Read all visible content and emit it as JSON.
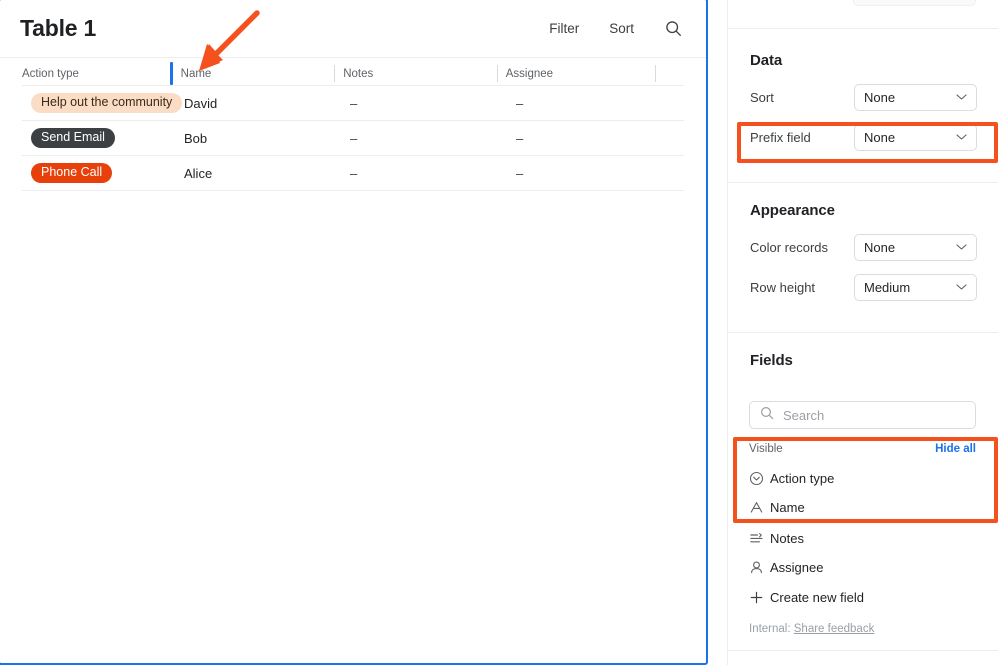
{
  "table_view": {
    "title": "Table 1",
    "toolbar": {
      "filter_label": "Filter",
      "sort_label": "Sort",
      "search_icon": "search-icon"
    },
    "columns": [
      {
        "label": "Action type"
      },
      {
        "label": "Name"
      },
      {
        "label": "Notes"
      },
      {
        "label": "Assignee"
      }
    ],
    "drag_indicator_color": "#1a73e8",
    "rows": [
      {
        "action_type": "Help out the community",
        "tag_bg": "#fbdcc5",
        "tag_fg": "#3c2a1a",
        "name": "David",
        "notes": "–",
        "assignee": "–"
      },
      {
        "action_type": "Send Email",
        "tag_bg": "#3c4043",
        "tag_fg": "#ffffff",
        "name": "Bob",
        "notes": "–",
        "assignee": "–"
      },
      {
        "action_type": "Phone Call",
        "tag_bg": "#e8400a",
        "tag_fg": "#ffffff",
        "name": "Alice",
        "notes": "–",
        "assignee": "–"
      }
    ]
  },
  "sidebar": {
    "data_section": {
      "title": "Data",
      "settings": [
        {
          "label": "Sort",
          "value": "None",
          "icon": "chevron-down-icon"
        },
        {
          "label": "Prefix field",
          "value": "None",
          "icon": "chevron-down-icon"
        }
      ]
    },
    "appearance_section": {
      "title": "Appearance",
      "settings": [
        {
          "label": "Color records",
          "value": "None",
          "icon": "chevron-down-icon"
        },
        {
          "label": "Row height",
          "value": "Medium",
          "icon": "chevron-down-icon"
        }
      ]
    },
    "fields_section": {
      "title": "Fields",
      "search": {
        "placeholder": "Search",
        "value": "",
        "icon": "search-icon"
      },
      "visible_label": "Visible",
      "hide_all_label": "Hide all",
      "hide_all_color": "#1a73e8",
      "fields": [
        {
          "label": "Action type",
          "icon": "single-select-icon"
        },
        {
          "label": "Name",
          "icon": "text-field-icon"
        },
        {
          "label": "Notes",
          "icon": "long-text-icon"
        },
        {
          "label": "Assignee",
          "icon": "user-icon"
        }
      ],
      "create_new_field_label": "Create new field",
      "create_new_field_icon": "plus-icon"
    },
    "footer": {
      "prefix": "Internal:",
      "link_label": "Share feedback"
    }
  },
  "annotations": {
    "color": "#f4511e",
    "boxes": [
      {
        "name": "prefix-field-highlight"
      },
      {
        "name": "visible-fields-highlight"
      }
    ],
    "arrow": {
      "name": "name-column-arrow"
    }
  }
}
